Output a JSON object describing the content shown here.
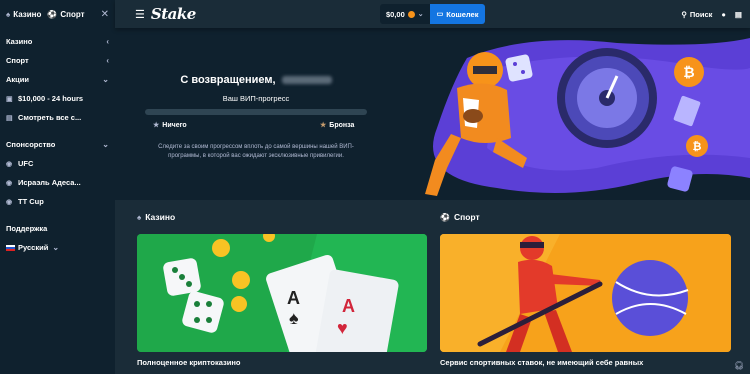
{
  "sidebar": {
    "tabs": [
      {
        "label": "Казино",
        "icon": "casino-icon"
      },
      {
        "label": "Спорт",
        "icon": "sport-icon"
      }
    ],
    "items": [
      {
        "label": "Казино"
      },
      {
        "label": "Спорт"
      },
      {
        "label": "Акции"
      },
      {
        "label": "$10,000 - 24 hours"
      },
      {
        "label": "Смотреть все с..."
      },
      {
        "label": "Спонсорство"
      },
      {
        "label": "UFC"
      },
      {
        "label": "Исраэль Адеса..."
      },
      {
        "label": "TT Cup"
      },
      {
        "label": "Поддержка"
      },
      {
        "label": "Русский"
      }
    ]
  },
  "header": {
    "logo": "Stake",
    "balance": "$0,00",
    "wallet_label": "Кошелек",
    "search_label": "Поиск"
  },
  "hero": {
    "welcome": "С возвращением,",
    "vip_title": "Ваш ВИП-прогресс",
    "progress": 0,
    "from_level": "Ничего",
    "to_level": "Бронза",
    "description": "Следите за своим прогрессом вплоть до самой вершины нашей ВИП-программы, в которой вас ожидают эксклюзивные привилегии."
  },
  "sections": {
    "casino": {
      "title": "Казино",
      "caption": "Полноценное криптоказино"
    },
    "sport": {
      "title": "Спорт",
      "caption": "Сервис спортивных ставок, не имеющий себе равных"
    }
  },
  "colors": {
    "accent": "#1475e1",
    "bg": "#1a2c38",
    "panel": "#0f212e",
    "casino_card": "#1fa84a",
    "sport_card": "#f7a21b"
  }
}
